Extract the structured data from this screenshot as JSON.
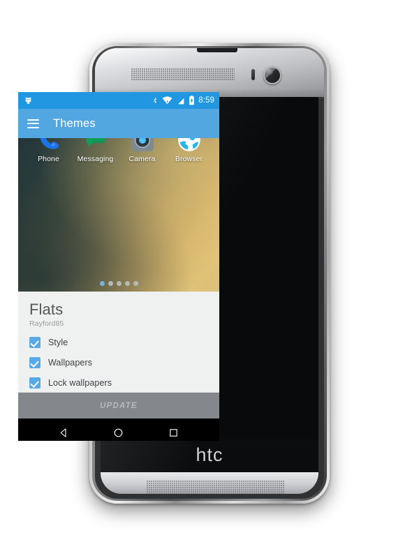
{
  "device": {
    "brand_logo": "htc",
    "parts": {
      "earpiece_grille": "speaker-grille",
      "bottom_grille": "speaker-grille",
      "proximity_sensor": "sensor",
      "front_camera": "front-camera"
    }
  },
  "status_bar": {
    "background": "#2196e1",
    "notification_icon": "cyanogenmod-icon",
    "icons": [
      {
        "name": "bluetooth-icon"
      },
      {
        "name": "wifi-icon"
      },
      {
        "name": "signal-off-icon"
      },
      {
        "name": "battery-charging-icon"
      }
    ],
    "clock": "8:59"
  },
  "app_bar": {
    "background": "#53a7e0",
    "menu_icon": "hamburger-menu-icon",
    "title": "Themes"
  },
  "home_preview": {
    "dock_apps": [
      {
        "label": "Phone",
        "icon": "phone-icon"
      },
      {
        "label": "Messaging",
        "icon": "messaging-icon"
      },
      {
        "label": "Camera",
        "icon": "camera-icon"
      },
      {
        "label": "Browser",
        "icon": "browser-icon"
      }
    ],
    "page_dots": {
      "count": 5,
      "active_index": 0,
      "active_color": "#6bb7e8",
      "inactive_color": "#b4b8b8"
    }
  },
  "theme_card": {
    "background": "#eff0f0",
    "title": "Flats",
    "author": "Rayford85",
    "options": [
      {
        "label": "Style",
        "checked": true
      },
      {
        "label": "Wallpapers",
        "checked": true
      },
      {
        "label": "Lock wallpapers",
        "checked": true
      }
    ],
    "checkbox_color": "#57a9e8"
  },
  "update_button": {
    "label": "UPDATE",
    "background": "#84878b",
    "text_color": "#b8babd",
    "enabled": false
  },
  "nav_bar": {
    "background": "#000000",
    "buttons": [
      {
        "name": "back-button",
        "icon": "back-triangle-icon"
      },
      {
        "name": "home-button",
        "icon": "home-circle-icon"
      },
      {
        "name": "recents-button",
        "icon": "recents-square-icon"
      }
    ]
  }
}
